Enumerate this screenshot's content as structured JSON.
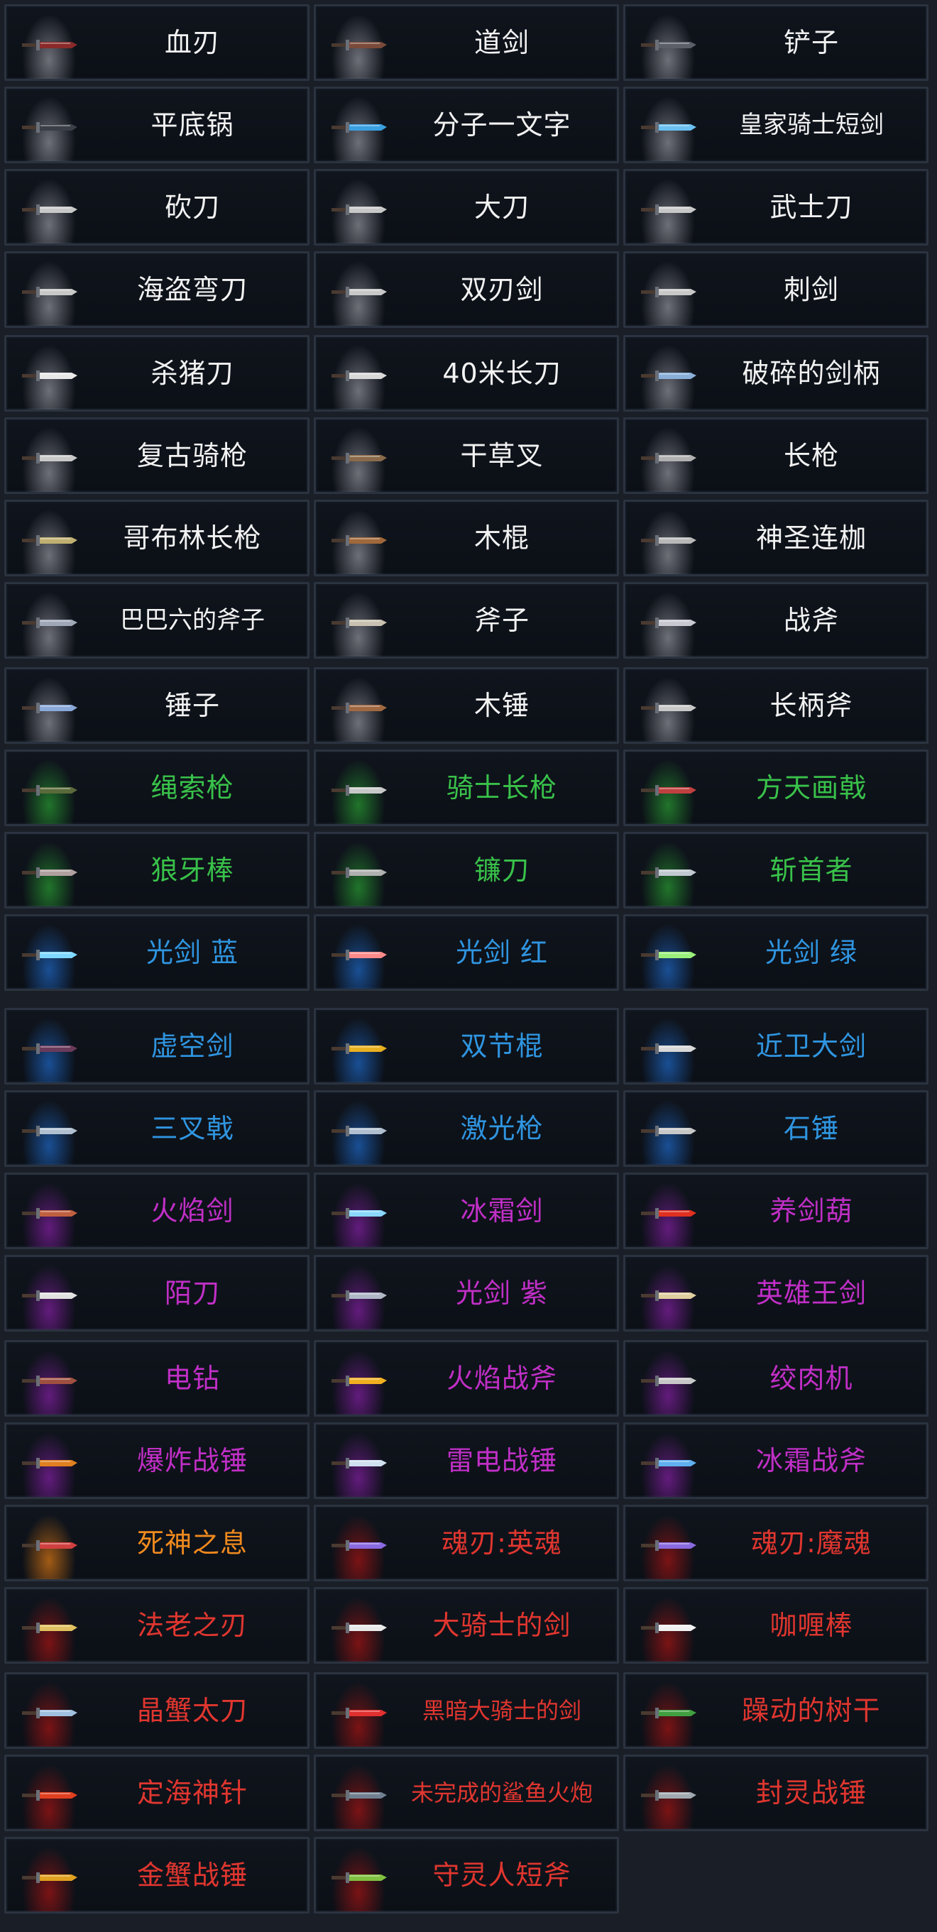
{
  "rarity_colors": {
    "white": "#f2f2f2",
    "green": "#39c24a",
    "blue": "#2f95e0",
    "purple": "#c02fc6",
    "orange": "#f08a1e",
    "red": "#e0362f"
  },
  "rarity_glow": {
    "white": "rgba(190,190,200,0.55)",
    "green": "rgba(40,150,50,0.75)",
    "blue": "rgba(30,100,190,0.75)",
    "purple": "rgba(120,30,150,0.8)",
    "orange": "rgba(200,110,20,0.8)",
    "red": "rgba(150,20,20,0.8)"
  },
  "weapons": [
    {
      "name": "血刃",
      "rarity": "white",
      "icon": "blood-blade-icon",
      "color": "#8a2a2a"
    },
    {
      "name": "道剑",
      "rarity": "white",
      "icon": "dao-sword-icon",
      "color": "#7a4a3a"
    },
    {
      "name": "铲子",
      "rarity": "white",
      "icon": "shovel-icon",
      "color": "#5a5f68"
    },
    {
      "name": "平底锅",
      "rarity": "white",
      "icon": "frying-pan-icon",
      "color": "#3a3f48"
    },
    {
      "name": "分子一文字",
      "rarity": "white",
      "icon": "molecular-katana-icon",
      "color": "#3aa0e0"
    },
    {
      "name": "皇家骑士短剑",
      "rarity": "white",
      "icon": "royal-knight-dagger-icon",
      "color": "#6ac0f0"
    },
    {
      "name": "砍刀",
      "rarity": "white",
      "icon": "machete-icon",
      "color": "#c8c8c8"
    },
    {
      "name": "大刀",
      "rarity": "white",
      "icon": "broadsword-icon",
      "color": "#c8c8c8"
    },
    {
      "name": "武士刀",
      "rarity": "white",
      "icon": "katana-icon",
      "color": "#c8c8c8"
    },
    {
      "name": "海盗弯刀",
      "rarity": "white",
      "icon": "pirate-cutlass-icon",
      "color": "#c8c8c8"
    },
    {
      "name": "双刃剑",
      "rarity": "white",
      "icon": "double-edged-sword-icon",
      "color": "#c8c8c8"
    },
    {
      "name": "刺剑",
      "rarity": "white",
      "icon": "rapier-icon",
      "color": "#c8c8c8"
    },
    {
      "name": "杀猪刀",
      "rarity": "white",
      "icon": "butcher-knife-icon",
      "color": "#e8e8e8"
    },
    {
      "name": "40米长刀",
      "rarity": "white",
      "icon": "long-blade-icon",
      "color": "#d8d8d8"
    },
    {
      "name": "破碎的剑柄",
      "rarity": "white",
      "icon": "broken-hilt-icon",
      "color": "#8ab0d8"
    },
    {
      "name": "复古骑枪",
      "rarity": "white",
      "icon": "vintage-lance-icon",
      "color": "#c8c8c8"
    },
    {
      "name": "干草叉",
      "rarity": "white",
      "icon": "pitchfork-icon",
      "color": "#8a6a4a"
    },
    {
      "name": "长枪",
      "rarity": "white",
      "icon": "spear-icon",
      "color": "#b0b0b0"
    },
    {
      "name": "哥布林长枪",
      "rarity": "white",
      "icon": "goblin-spear-icon",
      "color": "#c0b070"
    },
    {
      "name": "木棍",
      "rarity": "white",
      "icon": "wooden-stick-icon",
      "color": "#a0683a"
    },
    {
      "name": "神圣连枷",
      "rarity": "white",
      "icon": "holy-flail-icon",
      "color": "#b8b8b8"
    },
    {
      "name": "巴巴六的斧子",
      "rarity": "white",
      "icon": "babaliu-axe-icon",
      "color": "#a0a8b8"
    },
    {
      "name": "斧子",
      "rarity": "white",
      "icon": "axe-icon",
      "color": "#c8c0b0"
    },
    {
      "name": "战斧",
      "rarity": "white",
      "icon": "battle-axe-icon",
      "color": "#c8c8d0"
    },
    {
      "name": "锤子",
      "rarity": "white",
      "icon": "hammer-icon",
      "color": "#8aa8d8"
    },
    {
      "name": "木锤",
      "rarity": "white",
      "icon": "wooden-mallet-icon",
      "color": "#a06840"
    },
    {
      "name": "长柄斧",
      "rarity": "white",
      "icon": "halberd-icon",
      "color": "#c8c8c8"
    },
    {
      "name": "绳索枪",
      "rarity": "green",
      "icon": "grapple-gun-icon",
      "color": "#5a6a3a"
    },
    {
      "name": "骑士长枪",
      "rarity": "green",
      "icon": "knight-lance-icon",
      "color": "#c8c8c8"
    },
    {
      "name": "方天画戟",
      "rarity": "green",
      "icon": "sky-piercer-halberd-icon",
      "color": "#c04040"
    },
    {
      "name": "狼牙棒",
      "rarity": "green",
      "icon": "spiked-club-icon",
      "color": "#b0a0a0"
    },
    {
      "name": "镰刀",
      "rarity": "green",
      "icon": "sickle-icon",
      "color": "#b0b0b0"
    },
    {
      "name": "斩首者",
      "rarity": "green",
      "icon": "beheader-axe-icon",
      "color": "#c0c8d0"
    },
    {
      "name": "光剑  蓝",
      "rarity": "blue",
      "icon": "lightsaber-blue-icon",
      "color": "#7fd8ff"
    },
    {
      "name": "光剑  红",
      "rarity": "blue",
      "icon": "lightsaber-red-icon",
      "color": "#ff8a8a"
    },
    {
      "name": "光剑  绿",
      "rarity": "blue",
      "icon": "lightsaber-green-icon",
      "color": "#9af07a"
    },
    {
      "name": "虚空剑",
      "rarity": "blue",
      "icon": "void-sword-icon",
      "color": "#6a3a5a"
    },
    {
      "name": "双节棍",
      "rarity": "blue",
      "icon": "nunchaku-icon",
      "color": "#e8b020"
    },
    {
      "name": "近卫大剑",
      "rarity": "blue",
      "icon": "guard-greatsword-icon",
      "color": "#d8d8d8"
    },
    {
      "name": "三叉戟",
      "rarity": "blue",
      "icon": "trident-icon",
      "color": "#b0c0d0"
    },
    {
      "name": "激光枪",
      "rarity": "blue",
      "icon": "laser-spear-icon",
      "color": "#b0c0d0"
    },
    {
      "name": "石锤",
      "rarity": "blue",
      "icon": "stone-hammer-icon",
      "color": "#c8c8c8"
    },
    {
      "name": "火焰剑",
      "rarity": "purple",
      "icon": "flame-sword-icon",
      "color": "#c06040"
    },
    {
      "name": "冰霜剑",
      "rarity": "purple",
      "icon": "frost-sword-icon",
      "color": "#8ad8ff"
    },
    {
      "name": "养剑葫",
      "rarity": "purple",
      "icon": "sword-gourd-icon",
      "color": "#e03020"
    },
    {
      "name": "陌刀",
      "rarity": "purple",
      "icon": "mo-dao-icon",
      "color": "#e0e0e0"
    },
    {
      "name": "光剑  紫",
      "rarity": "purple",
      "icon": "lightsaber-purple-icon",
      "color": "#b0b8c8"
    },
    {
      "name": "英雄王剑",
      "rarity": "purple",
      "icon": "hero-king-sword-icon",
      "color": "#e0d0a0"
    },
    {
      "name": "电钻",
      "rarity": "purple",
      "icon": "drill-icon",
      "color": "#a05040"
    },
    {
      "name": "火焰战斧",
      "rarity": "purple",
      "icon": "flame-battle-axe-icon",
      "color": "#f0b020"
    },
    {
      "name": "绞肉机",
      "rarity": "purple",
      "icon": "meat-grinder-icon",
      "color": "#c8c8c8"
    },
    {
      "name": "爆炸战锤",
      "rarity": "purple",
      "icon": "explosive-warhammer-icon",
      "color": "#e08020"
    },
    {
      "name": "雷电战锤",
      "rarity": "purple",
      "icon": "thunder-warhammer-icon",
      "color": "#d0e0f0"
    },
    {
      "name": "冰霜战斧",
      "rarity": "purple",
      "icon": "frost-battle-axe-icon",
      "color": "#60b0f0"
    },
    {
      "name": "死神之息",
      "rarity": "orange",
      "icon": "reaper-breath-icon",
      "color": "#d04040"
    },
    {
      "name": "魂刃:英魂",
      "rarity": "red",
      "icon": "soul-blade-hero-icon",
      "color": "#8a6ae0"
    },
    {
      "name": "魂刃:魔魂",
      "rarity": "red",
      "icon": "soul-blade-demon-icon",
      "color": "#8a6ae0"
    },
    {
      "name": "法老之刃",
      "rarity": "red",
      "icon": "pharaoh-blade-icon",
      "color": "#e0c060"
    },
    {
      "name": "大骑士的剑",
      "rarity": "red",
      "icon": "grand-knight-sword-icon",
      "color": "#e8e8e8"
    },
    {
      "name": "咖喱棒",
      "rarity": "red",
      "icon": "excalibur-icon",
      "color": "#f0f0f0"
    },
    {
      "name": "晶蟹太刀",
      "rarity": "red",
      "icon": "crystal-crab-tachi-icon",
      "color": "#a0c0e0"
    },
    {
      "name": "黑暗大骑士的剑",
      "rarity": "red",
      "icon": "dark-grand-knight-sword-icon",
      "color": "#e03030"
    },
    {
      "name": "躁动的树干",
      "rarity": "red",
      "icon": "restless-trunk-icon",
      "color": "#40a040"
    },
    {
      "name": "定海神针",
      "rarity": "red",
      "icon": "ocean-pillar-icon",
      "color": "#e04020"
    },
    {
      "name": "未完成的鲨鱼火炮",
      "rarity": "red",
      "icon": "unfinished-shark-cannon-icon",
      "color": "#708090"
    },
    {
      "name": "封灵战锤",
      "rarity": "red",
      "icon": "spirit-seal-warhammer-icon",
      "color": "#a0a8b0"
    },
    {
      "name": "金蟹战锤",
      "rarity": "red",
      "icon": "golden-crab-warhammer-icon",
      "color": "#e0a020"
    },
    {
      "name": "守灵人短斧",
      "rarity": "red",
      "icon": "warden-hatchet-icon",
      "color": "#80c040"
    }
  ]
}
